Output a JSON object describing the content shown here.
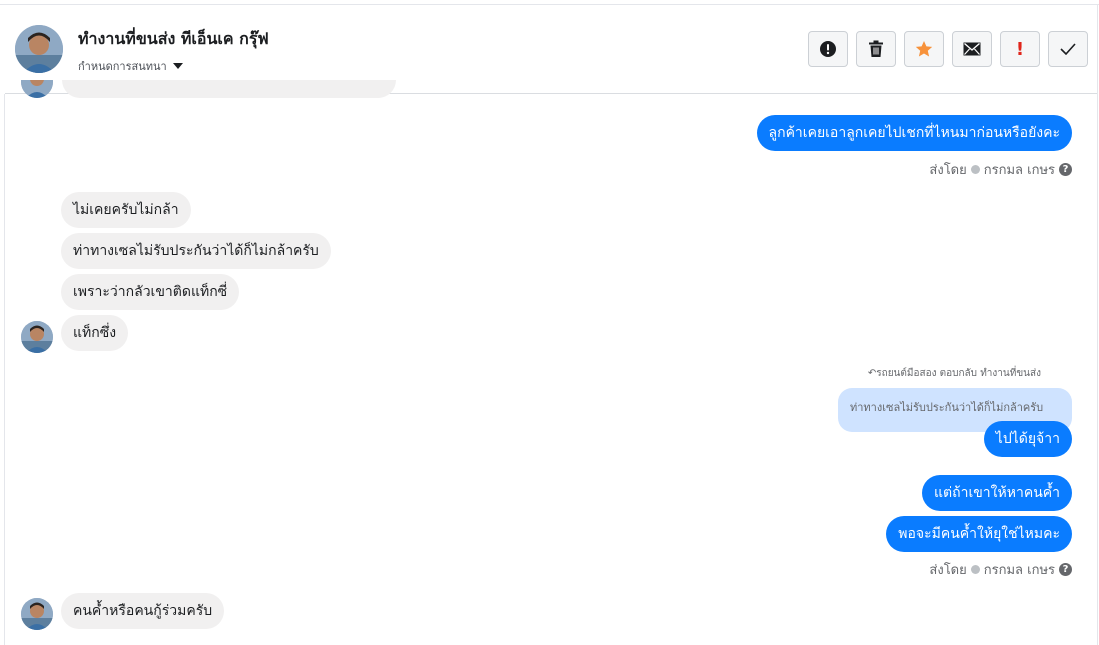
{
  "conversation": {
    "contact_name": "ทำงานที่ขนส่ง ทีเอ็นเค กรุ๊ฟ",
    "assign_label": "กำหนดการสนทนา"
  },
  "toolbar": {
    "buttons": [
      {
        "name": "report-button",
        "icon": "exclamation-circle-icon"
      },
      {
        "name": "delete-button",
        "icon": "trash-icon"
      },
      {
        "name": "star-button",
        "icon": "star-icon",
        "color": "#f7923b"
      },
      {
        "name": "mail-button",
        "icon": "envelope-icon"
      },
      {
        "name": "important-button",
        "label": "!",
        "color": "#e0251b"
      },
      {
        "name": "done-button",
        "icon": "check-icon"
      }
    ]
  },
  "messages": {
    "m1": "ลูกค้าเคยเอาลูกเคยไปเชกที่ไหนมาก่อนหรือยังคะ",
    "sent_by_1": "ส่งโดย",
    "sender_1": "กรกมล เกษร",
    "m2": "ไม่เคยครับไม่กล้า",
    "m3": "ท่าทางเซลไม่รับประกันว่าได้ก็ไม่กล้าครับ",
    "m4": "เพราะว่ากลัวเขาติดแท็กซี่",
    "m5": "แท็กซึ่ง",
    "reply_note": "รถยนต์มือสอง ตอบกลับ ทำงานที่ขนส่ง",
    "quoted": "ท่าทางเซลไม่รับประกันว่าได้ก็ไม่กล้าครับ",
    "m6": "ไปได้ยุจ้าา",
    "m7": "แต่ถ้าเขาให้หาคนค้ำ",
    "m8": "พอจะมีคนค้ำให้ยุใช่ไหมคะ",
    "sent_by_2": "ส่งโดย",
    "sender_2": "กรกมล เกษร",
    "m9": "คนค้ำหรือคนกู้ร่วมครับ"
  },
  "colors": {
    "outgoing_bubble": "#0a7cff",
    "incoming_bubble": "#f1f0f0",
    "quote_bubble": "#cfe3ff"
  }
}
